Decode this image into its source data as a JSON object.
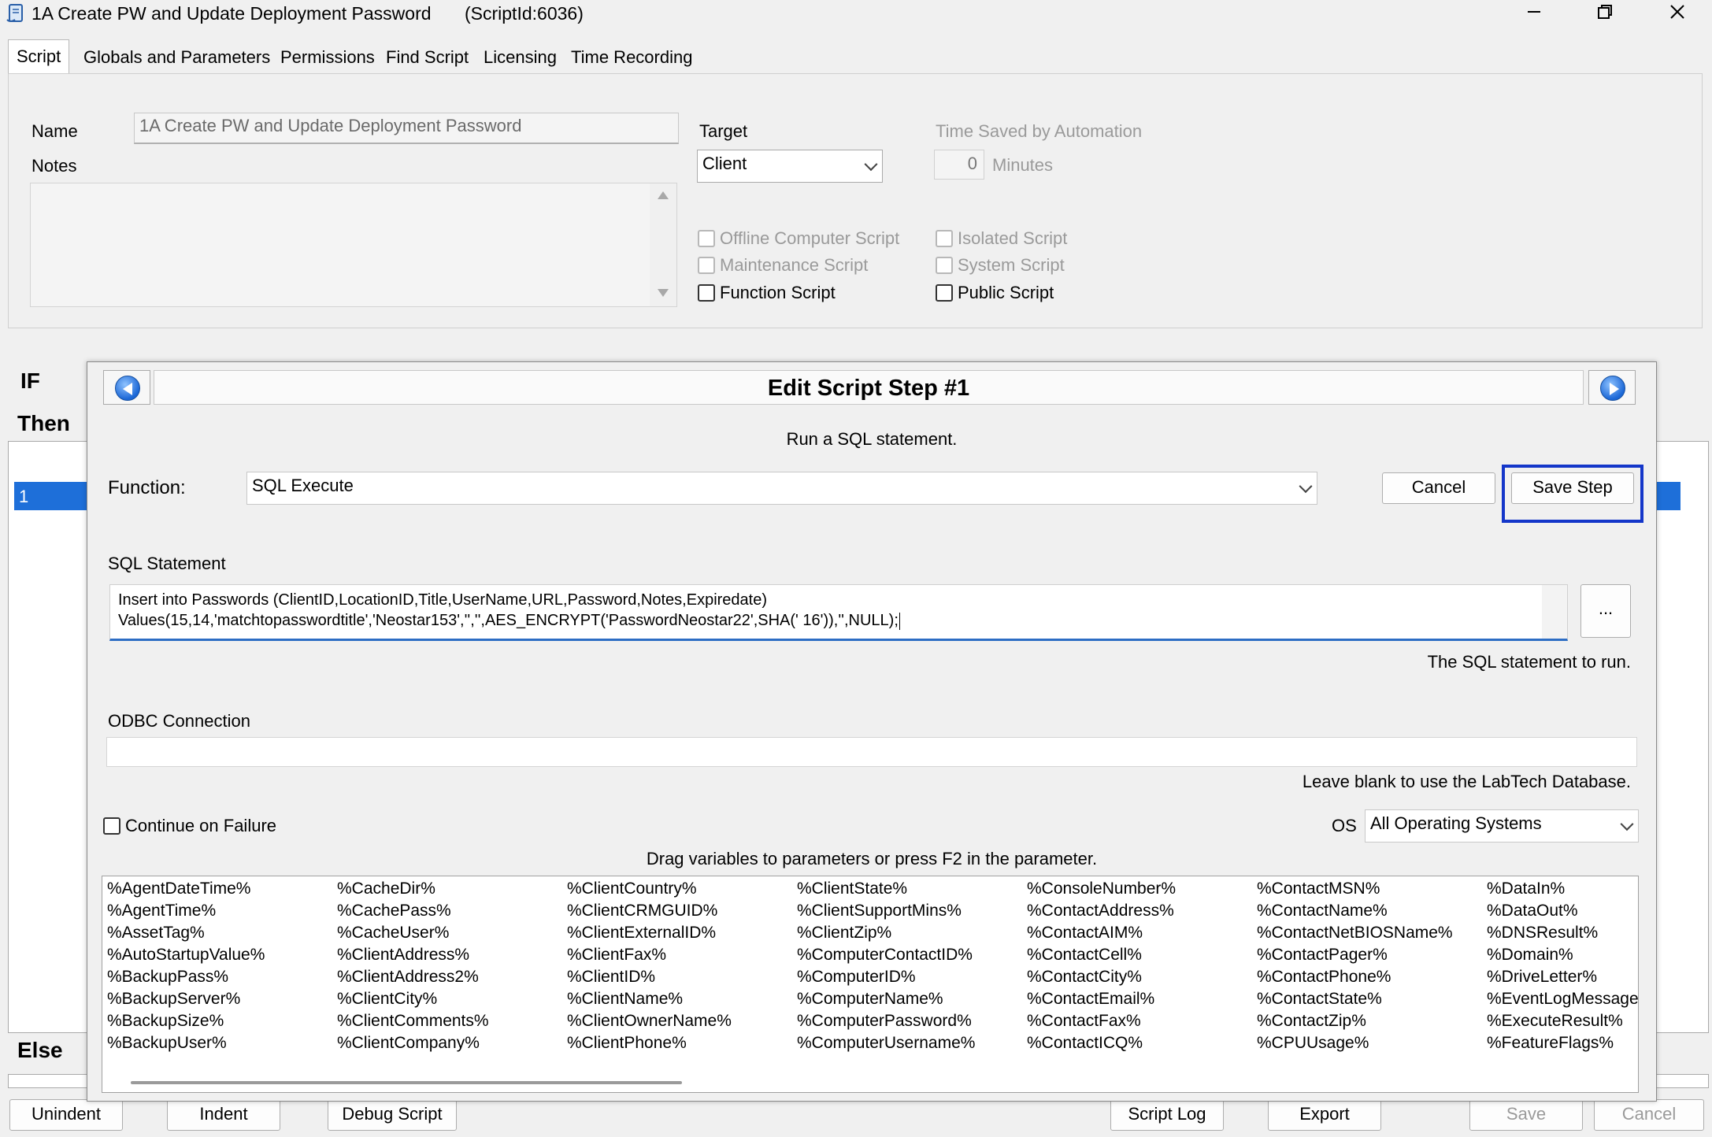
{
  "window": {
    "title": "1A Create PW and Update Deployment Password",
    "script_id": "(ScriptId:6036)"
  },
  "tabs": [
    "Script",
    "Globals and Parameters",
    "Permissions",
    "Find Script",
    "Licensing",
    "Time Recording"
  ],
  "script": {
    "name_label": "Name",
    "name_value": "1A Create PW and Update Deployment Password",
    "notes_label": "Notes",
    "target_label": "Target",
    "target_value": "Client",
    "time_saved_label": "Time Saved by Automation",
    "time_saved_value": "0",
    "minutes_label": "Minutes",
    "checkboxes": {
      "offline": "Offline Computer Script",
      "isolated": "Isolated Script",
      "maintenance": "Maintenance Script",
      "system": "System Script",
      "function": "Function Script",
      "public": "Public Script"
    }
  },
  "background": {
    "if_label": "IF",
    "then_label": "Then",
    "else_label": "Else",
    "row_number": "1",
    "buttons": [
      "Unindent",
      "Indent",
      "Debug Script",
      "Script Log",
      "Export",
      "Save",
      "Cancel"
    ]
  },
  "dialog": {
    "title": "Edit Script Step #1",
    "description": "Run a SQL statement.",
    "function_label": "Function:",
    "function_value": "SQL Execute",
    "cancel_label": "Cancel",
    "save_step_label": "Save Step",
    "sql_label": "SQL Statement",
    "sql_line1": "Insert into Passwords (ClientID,LocationID,Title,UserName,URL,Password,Notes,Expiredate)",
    "sql_line2": "Values(15,14,'matchtopasswordtitle','Neostar153','','',AES_ENCRYPT('PasswordNeostar22',SHA(' 16')),'',NULL);",
    "ellipsis_label": "...",
    "sql_hint": "The SQL statement to run.",
    "odbc_label": "ODBC Connection",
    "odbc_hint": "Leave blank to use the LabTech Database.",
    "continue_label": "Continue on Failure",
    "os_label": "OS",
    "os_value": "All Operating Systems",
    "drag_hint": "Drag variables to parameters or press F2 in the parameter.",
    "variables": [
      [
        "%AgentDateTime%",
        "%AgentTime%",
        "%AssetTag%",
        "%AutoStartupValue%",
        "%BackupPass%",
        "%BackupServer%",
        "%BackupSize%",
        "%BackupUser%"
      ],
      [
        "%CacheDir%",
        "%CachePass%",
        "%CacheUser%",
        "%ClientAddress%",
        "%ClientAddress2%",
        "%ClientCity%",
        "%ClientComments%",
        "%ClientCompany%"
      ],
      [
        "%ClientCountry%",
        "%ClientCRMGUID%",
        "%ClientExternalID%",
        "%ClientFax%",
        "%ClientID%",
        "%ClientName%",
        "%ClientOwnerName%",
        "%ClientPhone%"
      ],
      [
        "%ClientState%",
        "%ClientSupportMins%",
        "%ClientZip%",
        "%ComputerContactID%",
        "%ComputerID%",
        "%ComputerName%",
        "%ComputerPassword%",
        "%ComputerUsername%"
      ],
      [
        "%ConsoleNumber%",
        "%ContactAddress%",
        "%ContactAIM%",
        "%ContactCell%",
        "%ContactCity%",
        "%ContactEmail%",
        "%ContactFax%",
        "%ContactICQ%"
      ],
      [
        "%ContactMSN%",
        "%ContactName%",
        "%ContactNetBIOSName%",
        "%ContactPager%",
        "%ContactPhone%",
        "%ContactState%",
        "%ContactZip%",
        "%CPUUsage%"
      ],
      [
        "%DataIn%",
        "%DataOut%",
        "%DNSResult%",
        "%Domain%",
        "%DriveLetter%",
        "%EventLogMessage%",
        "%ExecuteResult%",
        "%FeatureFlags%"
      ]
    ]
  },
  "colors": {
    "accent": "#2d6dc4",
    "highlight_border": "#1436c9",
    "selection": "#1e6fd9"
  }
}
